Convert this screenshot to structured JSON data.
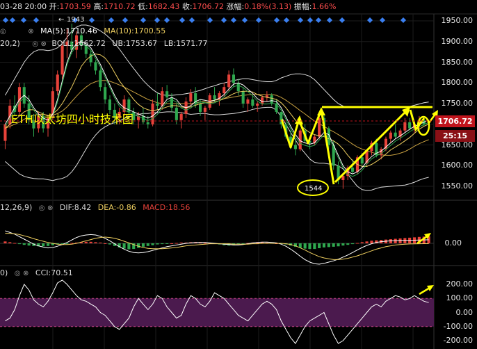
{
  "header": {
    "date": "03-28 20:00",
    "open_label": "开:",
    "open": "1703.59",
    "high_label": "高:",
    "high": "1710.72",
    "low_label": "低:",
    "low": "1682.43",
    "close_label": "收:",
    "close": "1706.72",
    "change_label": "涨幅:",
    "change": "0.18%(3.13)",
    "amp_label": "振幅:",
    "amp": "1.66%"
  },
  "main_indicators": {
    "ma5": "MA(5):1710.46",
    "ma10": "MA(10):1700.55",
    "boll_params": "20,2)",
    "boll": "BOLL:1662.72",
    "ub": "UB:1753.67",
    "lb": "LB:1571.77",
    "peak_label": "1943",
    "low_mark": "1544",
    "title": "ETH以太坊四小时技术图"
  },
  "price_axis": {
    "ticks": [
      "1950.00",
      "1900.00",
      "1850.00",
      "1800.00",
      "1750.00",
      "1700.00",
      "1650.00",
      "1600.00",
      "1550.00"
    ],
    "current_price": "1706.72",
    "countdown": "25:15"
  },
  "macd": {
    "params": "12,26,9)",
    "dif": "DIF:8.42",
    "dea": "DEA:-0.86",
    "macd": "MACD:18.56",
    "axis_zero": "0.00"
  },
  "cci": {
    "params": "0)",
    "value": "CCI:70.51",
    "ticks": [
      "200.00",
      "100.00",
      "0.00",
      "-100.00",
      "-200.00"
    ]
  },
  "colors": {
    "up": "#e8423a",
    "down": "#2fa84f",
    "annotation": "#ffff00",
    "ma5": "#ffffff",
    "ma10": "#f0d060",
    "boll_band": "#dddddd",
    "current_tag": "#c0141c",
    "countdown_tag": "#8a1016",
    "cci_band": "#4b1a4e",
    "marker": "#3a7ff0"
  },
  "chart_data": {
    "type": "candlestick",
    "y_range": [
      1520,
      1975
    ],
    "candles": [
      [
        1660,
        1700,
        1640,
        1700
      ],
      [
        1700,
        1760,
        1690,
        1745
      ],
      [
        1745,
        1770,
        1720,
        1730
      ],
      [
        1730,
        1800,
        1720,
        1790
      ],
      [
        1790,
        1800,
        1740,
        1750
      ],
      [
        1750,
        1770,
        1700,
        1710
      ],
      [
        1710,
        1725,
        1670,
        1690
      ],
      [
        1690,
        1730,
        1680,
        1720
      ],
      [
        1720,
        1730,
        1680,
        1690
      ],
      [
        1690,
        1720,
        1670,
        1715
      ],
      [
        1715,
        1790,
        1710,
        1780
      ],
      [
        1780,
        1830,
        1770,
        1820
      ],
      [
        1820,
        1900,
        1810,
        1890
      ],
      [
        1890,
        1930,
        1860,
        1900
      ],
      [
        1900,
        1943,
        1870,
        1880
      ],
      [
        1880,
        1925,
        1860,
        1915
      ],
      [
        1915,
        1925,
        1880,
        1890
      ],
      [
        1890,
        1895,
        1860,
        1870
      ],
      [
        1870,
        1880,
        1840,
        1850
      ],
      [
        1850,
        1855,
        1820,
        1830
      ],
      [
        1830,
        1835,
        1780,
        1790
      ],
      [
        1790,
        1800,
        1750,
        1760
      ],
      [
        1760,
        1770,
        1725,
        1735
      ],
      [
        1735,
        1750,
        1700,
        1715
      ],
      [
        1715,
        1740,
        1700,
        1730
      ],
      [
        1730,
        1770,
        1720,
        1760
      ],
      [
        1760,
        1765,
        1720,
        1730
      ],
      [
        1730,
        1740,
        1700,
        1710
      ],
      [
        1710,
        1730,
        1690,
        1720
      ],
      [
        1720,
        1740,
        1700,
        1705
      ],
      [
        1705,
        1720,
        1690,
        1700
      ],
      [
        1700,
        1760,
        1695,
        1750
      ],
      [
        1750,
        1775,
        1735,
        1745
      ],
      [
        1745,
        1790,
        1735,
        1780
      ],
      [
        1780,
        1795,
        1760,
        1765
      ],
      [
        1765,
        1775,
        1730,
        1740
      ],
      [
        1740,
        1750,
        1700,
        1710
      ],
      [
        1710,
        1730,
        1690,
        1725
      ],
      [
        1725,
        1765,
        1715,
        1755
      ],
      [
        1755,
        1785,
        1745,
        1775
      ],
      [
        1775,
        1790,
        1740,
        1750
      ],
      [
        1750,
        1760,
        1720,
        1730
      ],
      [
        1730,
        1745,
        1710,
        1740
      ],
      [
        1740,
        1775,
        1735,
        1770
      ],
      [
        1770,
        1790,
        1755,
        1760
      ],
      [
        1760,
        1780,
        1745,
        1775
      ],
      [
        1775,
        1800,
        1765,
        1790
      ],
      [
        1790,
        1830,
        1780,
        1820
      ],
      [
        1820,
        1835,
        1790,
        1800
      ],
      [
        1800,
        1810,
        1770,
        1780
      ],
      [
        1780,
        1790,
        1740,
        1750
      ],
      [
        1750,
        1765,
        1730,
        1760
      ],
      [
        1760,
        1770,
        1740,
        1745
      ],
      [
        1745,
        1755,
        1730,
        1750
      ],
      [
        1750,
        1770,
        1745,
        1765
      ],
      [
        1765,
        1780,
        1755,
        1770
      ],
      [
        1770,
        1775,
        1745,
        1750
      ],
      [
        1750,
        1760,
        1725,
        1730
      ],
      [
        1730,
        1705,
        1690,
        1700
      ],
      [
        1700,
        1705,
        1665,
        1670
      ],
      [
        1670,
        1685,
        1640,
        1650
      ],
      [
        1650,
        1665,
        1625,
        1640
      ],
      [
        1640,
        1690,
        1635,
        1685
      ],
      [
        1685,
        1700,
        1655,
        1660
      ],
      [
        1660,
        1670,
        1640,
        1655
      ],
      [
        1655,
        1675,
        1650,
        1670
      ],
      [
        1670,
        1720,
        1665,
        1715
      ],
      [
        1715,
        1725,
        1680,
        1690
      ],
      [
        1690,
        1695,
        1640,
        1650
      ],
      [
        1650,
        1660,
        1590,
        1600
      ],
      [
        1600,
        1610,
        1555,
        1565
      ],
      [
        1565,
        1580,
        1544,
        1575
      ],
      [
        1575,
        1600,
        1565,
        1595
      ],
      [
        1595,
        1615,
        1580,
        1585
      ],
      [
        1585,
        1625,
        1580,
        1620
      ],
      [
        1620,
        1630,
        1595,
        1605
      ],
      [
        1605,
        1640,
        1600,
        1635
      ],
      [
        1635,
        1660,
        1625,
        1655
      ],
      [
        1655,
        1665,
        1620,
        1625
      ],
      [
        1625,
        1645,
        1615,
        1640
      ],
      [
        1640,
        1670,
        1635,
        1665
      ],
      [
        1665,
        1685,
        1655,
        1680
      ],
      [
        1680,
        1700,
        1665,
        1670
      ],
      [
        1670,
        1690,
        1660,
        1685
      ],
      [
        1685,
        1715,
        1680,
        1705
      ],
      [
        1705,
        1715,
        1685,
        1690
      ],
      [
        1690,
        1705,
        1680,
        1700
      ],
      [
        1700,
        1720,
        1690,
        1710
      ],
      [
        1710,
        1715,
        1695,
        1700
      ],
      [
        1703.59,
        1710.72,
        1682.43,
        1706.72
      ]
    ],
    "ma5": [
      1700,
      1720,
      1740,
      1760,
      1770,
      1760,
      1740,
      1725,
      1715,
      1710,
      1725,
      1760,
      1805,
      1850,
      1880,
      1895,
      1900,
      1895,
      1885,
      1865,
      1845,
      1820,
      1795,
      1770,
      1750,
      1740,
      1735,
      1730,
      1725,
      1720,
      1715,
      1720,
      1730,
      1745,
      1760,
      1765,
      1760,
      1745,
      1740,
      1745,
      1755,
      1760,
      1758,
      1755,
      1758,
      1763,
      1772,
      1785,
      1797,
      1800,
      1795,
      1785,
      1775,
      1762,
      1755,
      1755,
      1757,
      1755,
      1740,
      1718,
      1695,
      1675,
      1660,
      1655,
      1652,
      1655,
      1668,
      1680,
      1675,
      1650,
      1625,
      1600,
      1585,
      1580,
      1585,
      1595,
      1610,
      1622,
      1630,
      1635,
      1645,
      1655,
      1665,
      1672,
      1680,
      1688,
      1695,
      1700,
      1705,
      1710.46
    ],
    "ma10": [
      1690,
      1700,
      1710,
      1720,
      1730,
      1735,
      1735,
      1730,
      1725,
      1720,
      1725,
      1735,
      1750,
      1770,
      1790,
      1815,
      1840,
      1855,
      1865,
      1870,
      1868,
      1860,
      1845,
      1825,
      1805,
      1790,
      1775,
      1760,
      1748,
      1740,
      1735,
      1733,
      1735,
      1738,
      1742,
      1745,
      1745,
      1742,
      1740,
      1742,
      1746,
      1750,
      1752,
      1752,
      1754,
      1757,
      1762,
      1768,
      1774,
      1778,
      1780,
      1780,
      1778,
      1772,
      1768,
      1765,
      1763,
      1760,
      1752,
      1740,
      1725,
      1710,
      1698,
      1688,
      1680,
      1675,
      1672,
      1670,
      1665,
      1660,
      1652,
      1640,
      1625,
      1612,
      1603,
      1598,
      1598,
      1603,
      1610,
      1618,
      1628,
      1638,
      1645,
      1652,
      1660,
      1668,
      1678,
      1688,
      1695,
      1700.55
    ],
    "boll_mid": [
      1690,
      1695,
      1700,
      1705,
      1712,
      1718,
      1722,
      1724,
      1724,
      1722,
      1722,
      1726,
      1732,
      1742,
      1755,
      1768,
      1780,
      1790,
      1798,
      1803,
      1806,
      1806,
      1804,
      1800,
      1795,
      1790,
      1784,
      1778,
      1772,
      1766,
      1760,
      1756,
      1752,
      1750,
      1750,
      1750,
      1750,
      1750,
      1750,
      1750,
      1752,
      1754,
      1756,
      1757,
      1758,
      1760,
      1762,
      1764,
      1766,
      1768,
      1770,
      1771,
      1772,
      1772,
      1772,
      1772,
      1772,
      1770,
      1765,
      1758,
      1750,
      1742,
      1733,
      1725,
      1716,
      1708,
      1701,
      1695,
      1688,
      1682,
      1675,
      1668,
      1660,
      1652,
      1645,
      1640,
      1636,
      1632,
      1629,
      1626,
      1625,
      1625,
      1627,
      1630,
      1634,
      1640,
      1647,
      1653,
      1658,
      1662.72
    ],
    "boll_ub": [
      1770,
      1790,
      1810,
      1830,
      1850,
      1865,
      1875,
      1880,
      1880,
      1878,
      1880,
      1885,
      1895,
      1910,
      1925,
      1935,
      1940,
      1940,
      1937,
      1932,
      1926,
      1918,
      1908,
      1896,
      1882,
      1866,
      1850,
      1835,
      1820,
      1806,
      1794,
      1784,
      1776,
      1771,
      1770,
      1770,
      1771,
      1772,
      1774,
      1776,
      1779,
      1782,
      1786,
      1790,
      1793,
      1797,
      1800,
      1803,
      1806,
      1808,
      1810,
      1810,
      1808,
      1806,
      1804,
      1803,
      1803,
      1806,
      1812,
      1816,
      1820,
      1822,
      1822,
      1820,
      1816,
      1808,
      1796,
      1784,
      1772,
      1760,
      1750,
      1744,
      1741,
      1740,
      1740,
      1741,
      1742,
      1743,
      1743,
      1742,
      1741,
      1740,
      1740,
      1740,
      1741,
      1743,
      1746,
      1749,
      1752,
      1753.67
    ],
    "boll_lb": [
      1610,
      1600,
      1590,
      1580,
      1574,
      1571,
      1569,
      1568,
      1568,
      1566,
      1564,
      1567,
      1569,
      1574,
      1585,
      1601,
      1620,
      1640,
      1659,
      1674,
      1686,
      1694,
      1700,
      1704,
      1708,
      1714,
      1718,
      1721,
      1724,
      1726,
      1726,
      1728,
      1728,
      1729,
      1730,
      1730,
      1729,
      1728,
      1726,
      1724,
      1725,
      1726,
      1726,
      1724,
      1723,
      1723,
      1724,
      1725,
      1726,
      1728,
      1730,
      1732,
      1736,
      1738,
      1740,
      1741,
      1741,
      1734,
      1718,
      1700,
      1680,
      1662,
      1644,
      1630,
      1616,
      1608,
      1606,
      1606,
      1604,
      1604,
      1600,
      1592,
      1579,
      1564,
      1550,
      1542,
      1540,
      1541,
      1545,
      1548,
      1549,
      1550,
      1551,
      1552,
      1553,
      1556,
      1560,
      1565,
      1569,
      1571.77
    ],
    "macd_hist": [
      5,
      3,
      1,
      -2,
      -4,
      -6,
      -7,
      -8,
      -8,
      -7,
      -5,
      -3,
      -2,
      -1,
      1,
      2,
      3,
      4,
      4,
      3,
      2,
      0,
      -3,
      -7,
      -11,
      -14,
      -16,
      -15,
      -12,
      -9,
      -7,
      -5,
      -3,
      -2,
      -1,
      0,
      1,
      2,
      2,
      3,
      3,
      2,
      1,
      0,
      -1,
      -3,
      -5,
      -6,
      -5,
      -3,
      -1,
      1,
      2,
      3,
      3,
      2,
      1,
      0,
      -1,
      -3,
      -6,
      -9,
      -12,
      -14,
      -15,
      -15,
      -13,
      -11,
      -10,
      -9,
      -8,
      -6,
      -4,
      -2,
      1,
      3,
      5,
      7,
      8,
      9,
      10,
      11,
      12,
      13,
      14,
      15,
      16,
      17,
      18,
      18.56
    ],
    "macd_dif": [
      30,
      26,
      22,
      16,
      10,
      4,
      -2,
      -6,
      -9,
      -11,
      -10,
      -7,
      -3,
      2,
      8,
      14,
      18,
      20,
      21,
      20,
      17,
      12,
      6,
      -1,
      -8,
      -14,
      -19,
      -22,
      -23,
      -22,
      -20,
      -17,
      -14,
      -11,
      -8,
      -6,
      -4,
      -2,
      0,
      1,
      2,
      2,
      2,
      1,
      0,
      -1,
      -2,
      -3,
      -4,
      -4,
      -3,
      -1,
      1,
      2,
      3,
      3,
      2,
      1,
      -2,
      -7,
      -14,
      -22,
      -31,
      -39,
      -45,
      -49,
      -50,
      -48,
      -45,
      -42,
      -38,
      -33,
      -28,
      -22,
      -16,
      -10,
      -5,
      -1,
      2,
      4,
      5,
      6,
      6,
      7,
      7,
      7,
      7.5,
      8,
      8.2,
      8.42
    ],
    "macd_dea": [
      24,
      24,
      23,
      21,
      18,
      15,
      11,
      8,
      5,
      2,
      0,
      -2,
      -3,
      -3,
      -2,
      0,
      3,
      6,
      9,
      12,
      14,
      15,
      14,
      12,
      9,
      5,
      1,
      -3,
      -7,
      -10,
      -12,
      -13,
      -13,
      -13,
      -12,
      -11,
      -10,
      -8,
      -6,
      -5,
      -4,
      -3,
      -2,
      -1,
      -1,
      -1,
      -1,
      -1,
      -2,
      -2,
      -2,
      -2,
      -1,
      -1,
      0,
      0,
      0,
      0,
      0,
      -1,
      -3,
      -6,
      -11,
      -16,
      -22,
      -27,
      -32,
      -35,
      -37,
      -39,
      -39,
      -38,
      -36,
      -33,
      -30,
      -26,
      -22,
      -18,
      -14,
      -11,
      -8,
      -6,
      -4,
      -3,
      -2,
      -1.5,
      -1.2,
      -1,
      -0.9,
      -0.86
    ],
    "cci": [
      -60,
      -40,
      20,
      120,
      200,
      160,
      90,
      60,
      40,
      80,
      140,
      210,
      230,
      200,
      160,
      120,
      90,
      80,
      60,
      40,
      0,
      -20,
      -60,
      -100,
      -120,
      -80,
      -40,
      40,
      100,
      60,
      20,
      60,
      120,
      100,
      40,
      0,
      -40,
      -20,
      60,
      120,
      100,
      60,
      40,
      80,
      140,
      120,
      100,
      60,
      20,
      -20,
      -40,
      -60,
      -20,
      20,
      60,
      80,
      60,
      20,
      -60,
      -120,
      -180,
      -220,
      -160,
      -100,
      -60,
      -40,
      -20,
      0,
      -80,
      -160,
      -220,
      -200,
      -160,
      -120,
      -80,
      -40,
      0,
      40,
      60,
      40,
      80,
      100,
      120,
      110,
      90,
      100,
      120,
      100,
      80,
      70.51
    ]
  }
}
